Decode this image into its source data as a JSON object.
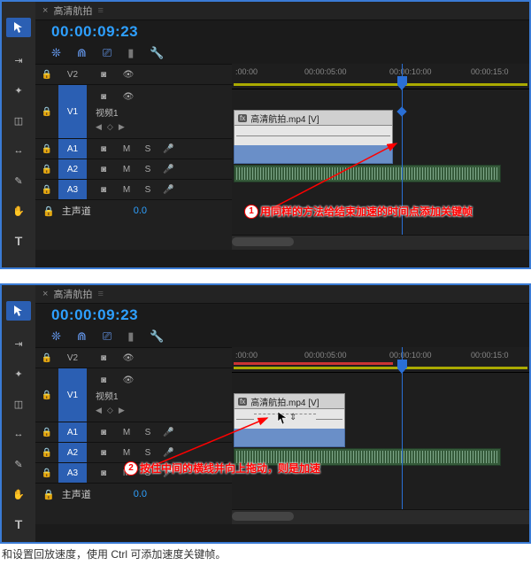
{
  "common": {
    "tab_x": "×",
    "tab_title": "高清航拍",
    "tab_drag": "≡",
    "timecode": "00:00:09:23",
    "ruler": {
      "t0": ":00:00",
      "t1": "00:00:05:00",
      "t2": "00:00:10:00",
      "t3": "00:00:15:0"
    },
    "labels": {
      "V2": "V2",
      "V1": "V1",
      "A1": "A1",
      "A2": "A2",
      "A3": "A3"
    },
    "video1": "视频1",
    "M": "M",
    "S": "S",
    "master": "主声道",
    "zero": "0.0",
    "clip_label": "高清航拍.mp4 [V]",
    "fx": "fx",
    "nav_l": "◀",
    "nav_o": "◇",
    "nav_r": "▶"
  },
  "anno1": {
    "n": "1",
    "text": "用同样的方法给结束加速的时间点添加关键帧"
  },
  "anno2": {
    "n": "2",
    "text": "按住中间的横线并向上拖动，则是加速"
  },
  "caption": "和设置回放速度，使用 Ctrl 可添加速度关键帧。"
}
